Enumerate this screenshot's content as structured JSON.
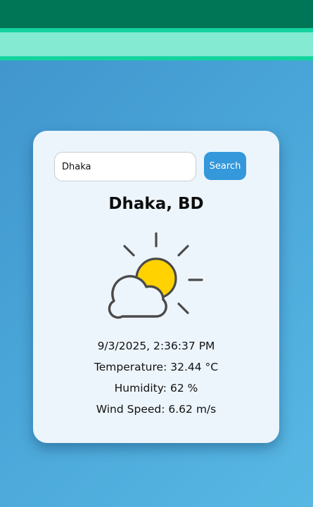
{
  "search": {
    "value": "Dhaka",
    "button_label": "Search"
  },
  "weather": {
    "city": "Dhaka, BD",
    "icon": "partly-cloudy-sun-icon",
    "datetime": "9/3/2025, 2:36:37 PM",
    "temperature": "Temperature: 32.44 °C",
    "humidity": "Humidity: 62 %",
    "wind_speed": "Wind Speed: 6.62 m/s"
  },
  "colors": {
    "header": "#007656",
    "accent": "#14d39f",
    "accent_light": "#85ead2",
    "card_bg": "#edf5fc",
    "button": "#3498db",
    "sun": "#ffd200",
    "outline": "#4a4a4a"
  }
}
